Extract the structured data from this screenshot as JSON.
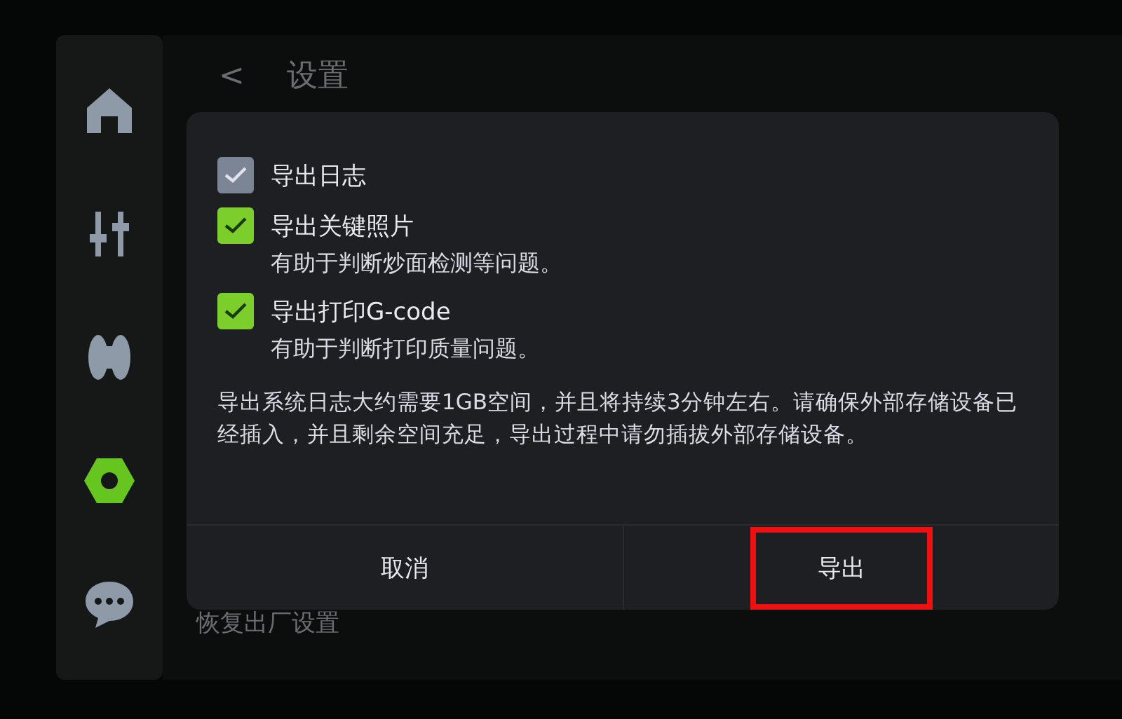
{
  "sidebar": {
    "items": [
      {
        "kind": "home",
        "selected": false
      },
      {
        "kind": "sliders",
        "selected": false
      },
      {
        "kind": "spool",
        "selected": false
      },
      {
        "kind": "nut",
        "selected": true
      },
      {
        "kind": "chat",
        "selected": false
      }
    ]
  },
  "header": {
    "back": "<",
    "title": "设置"
  },
  "background_item": "恢复出厂设置",
  "dialog": {
    "options": [
      {
        "label": "导出日志",
        "checked": true,
        "disabled": true
      },
      {
        "label": "导出关键照片",
        "note": "有助于判断炒面检测等问题。",
        "checked": true,
        "disabled": false
      },
      {
        "label": "导出打印G-code",
        "note": "有助于判断打印质量问题。",
        "checked": true,
        "disabled": false
      }
    ],
    "message": "导出系统日志大约需要1GB空间，并且将持续3分钟左右。请确保外部存储设备已经插入，并且剩余空间充足，导出过程中请勿插拔外部存储设备。",
    "buttons": [
      {
        "label": "取消",
        "highlighted": false
      },
      {
        "label": "导出",
        "highlighted": true
      }
    ]
  }
}
